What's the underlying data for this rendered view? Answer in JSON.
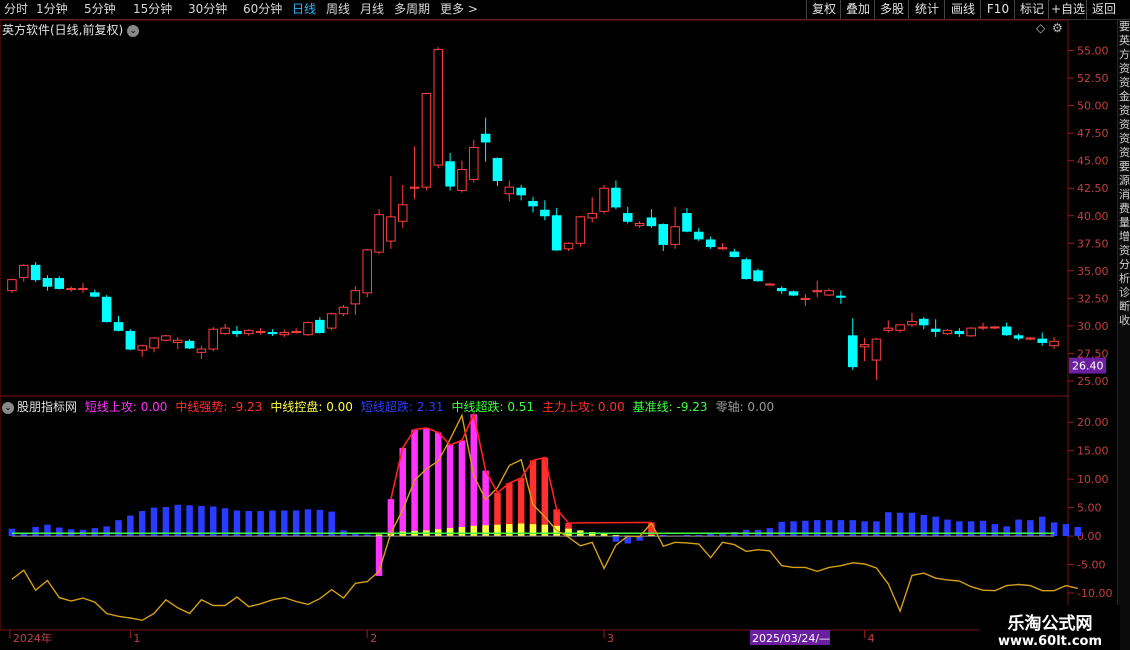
{
  "toolbar": {
    "periods": [
      "分时",
      "1分钟",
      "5分钟",
      "15分钟",
      "30分钟",
      "60分钟",
      "日线",
      "周线",
      "月线",
      "多周期",
      "更多 >"
    ],
    "active_period": "日线",
    "right_buttons": [
      "复权",
      "叠加",
      "多股",
      "统计",
      "画线",
      "F10",
      "标记",
      "+自选",
      "返回"
    ]
  },
  "chart_title": "英方软件(日线,前复权)",
  "indicator": {
    "name": "股朋指标网",
    "items": [
      {
        "label": "短线上攻: 0.00",
        "color": "#ff33ff"
      },
      {
        "label": "中线强势: -9.23",
        "color": "#ff3030"
      },
      {
        "label": "中线控盘: 0.00",
        "color": "#ffff40"
      },
      {
        "label": "短线超跌: 2.31",
        "color": "#2a3cff"
      },
      {
        "label": "中线超跌: 0.51",
        "color": "#40ff40"
      },
      {
        "label": "主力上攻: 0.00",
        "color": "#ff3030"
      },
      {
        "label": "基准线: -9.23",
        "color": "#40ff40"
      },
      {
        "label": "零轴: 0.00",
        "color": "#9a9a9a"
      }
    ]
  },
  "current_price_tag": "26.40",
  "date_axis": {
    "labels": [
      "2024年",
      "1",
      "2",
      "3",
      "4"
    ],
    "highlight": "2025/03/24/—"
  },
  "right_strip_text": "要英方资资金资资资资要源消费量增资分析诊断收",
  "watermark": {
    "line1": "乐淘公式网",
    "line2": "www.60lt.com"
  },
  "colors": {
    "up": "#ff4040",
    "down": "#00ffff",
    "bg": "#000000"
  },
  "chart_data": [
    {
      "type": "candlestick",
      "title": "英方软件(日线,前复权)",
      "ylim": [
        24.0,
        56.5
      ],
      "yticks": [
        25.0,
        27.5,
        30.0,
        32.5,
        35.0,
        37.5,
        40.0,
        42.5,
        45.0,
        47.5,
        50.0,
        52.5,
        55.0
      ],
      "ohlc": [
        [
          33.2,
          34.3,
          33.0,
          34.2
        ],
        [
          34.4,
          35.6,
          34.0,
          35.5
        ],
        [
          35.5,
          35.8,
          34.0,
          34.2
        ],
        [
          34.3,
          34.6,
          33.2,
          33.6
        ],
        [
          34.3,
          34.5,
          33.3,
          33.4
        ],
        [
          33.3,
          33.6,
          33.1,
          33.4
        ],
        [
          33.3,
          33.9,
          33.0,
          33.4
        ],
        [
          33.0,
          33.3,
          32.6,
          32.7
        ],
        [
          32.6,
          32.8,
          30.3,
          30.4
        ],
        [
          30.3,
          30.9,
          29.5,
          29.6
        ],
        [
          29.5,
          29.7,
          27.8,
          27.9
        ],
        [
          27.8,
          28.3,
          27.2,
          28.2
        ],
        [
          28.0,
          29.0,
          27.6,
          28.9
        ],
        [
          28.7,
          29.2,
          28.6,
          29.1
        ],
        [
          28.5,
          29.0,
          27.9,
          28.7
        ],
        [
          28.6,
          28.8,
          27.9,
          28.0
        ],
        [
          27.6,
          28.2,
          27.0,
          27.9
        ],
        [
          27.9,
          29.9,
          27.7,
          29.7
        ],
        [
          29.3,
          30.2,
          29.2,
          29.8
        ],
        [
          29.5,
          30.0,
          29.0,
          29.3
        ],
        [
          29.3,
          29.7,
          29.1,
          29.6
        ],
        [
          29.4,
          29.8,
          29.2,
          29.5
        ],
        [
          29.4,
          29.7,
          29.1,
          29.3
        ],
        [
          29.2,
          29.7,
          29.0,
          29.4
        ],
        [
          29.4,
          29.8,
          29.3,
          29.5
        ],
        [
          29.2,
          30.4,
          29.1,
          30.3
        ],
        [
          30.5,
          30.8,
          29.3,
          29.4
        ],
        [
          29.8,
          31.2,
          29.6,
          31.1
        ],
        [
          31.1,
          31.9,
          30.9,
          31.7
        ],
        [
          32.0,
          33.6,
          31.0,
          33.2
        ],
        [
          33.0,
          37.0,
          32.6,
          36.9
        ],
        [
          36.7,
          40.6,
          36.5,
          40.1
        ],
        [
          37.7,
          43.6,
          37.0,
          39.9
        ],
        [
          39.5,
          42.8,
          38.9,
          41.0
        ],
        [
          42.5,
          46.3,
          41.5,
          42.6
        ],
        [
          42.6,
          49.9,
          42.3,
          51.1
        ],
        [
          44.6,
          55.3,
          44.3,
          55.1
        ],
        [
          44.9,
          45.7,
          42.3,
          42.7
        ],
        [
          42.3,
          45.0,
          42.1,
          44.2
        ],
        [
          43.3,
          46.9,
          43.0,
          46.2
        ],
        [
          47.4,
          48.9,
          44.9,
          46.7
        ],
        [
          45.2,
          45.3,
          42.7,
          43.2
        ],
        [
          42.0,
          43.2,
          41.3,
          42.6
        ],
        [
          42.5,
          42.8,
          41.4,
          41.9
        ],
        [
          41.3,
          41.7,
          40.3,
          40.9
        ],
        [
          40.5,
          41.4,
          39.6,
          40.0
        ],
        [
          40.0,
          40.7,
          36.8,
          36.9
        ],
        [
          37.0,
          37.6,
          36.8,
          37.5
        ],
        [
          37.5,
          40.0,
          37.2,
          39.9
        ],
        [
          39.8,
          41.7,
          39.4,
          40.2
        ],
        [
          40.4,
          42.8,
          40.2,
          42.5
        ],
        [
          42.5,
          43.2,
          40.6,
          40.8
        ],
        [
          40.2,
          40.8,
          39.3,
          39.5
        ],
        [
          39.1,
          39.5,
          38.9,
          39.3
        ],
        [
          39.8,
          40.6,
          38.9,
          39.1
        ],
        [
          39.2,
          39.3,
          36.8,
          37.4
        ],
        [
          37.4,
          40.8,
          37.0,
          39.0
        ],
        [
          40.2,
          40.7,
          38.5,
          38.6
        ],
        [
          38.5,
          38.9,
          37.7,
          37.9
        ],
        [
          37.8,
          38.1,
          37.0,
          37.2
        ],
        [
          37.0,
          37.5,
          36.9,
          37.1
        ],
        [
          36.7,
          37.0,
          36.2,
          36.3
        ],
        [
          36.0,
          36.2,
          34.2,
          34.3
        ],
        [
          35.0,
          35.2,
          34.0,
          34.1
        ],
        [
          33.8,
          33.9,
          33.7,
          33.8
        ],
        [
          33.4,
          33.6,
          32.9,
          33.2
        ],
        [
          33.1,
          33.2,
          32.7,
          32.8
        ],
        [
          32.4,
          32.9,
          31.8,
          32.5
        ],
        [
          33.1,
          34.1,
          32.6,
          33.2
        ],
        [
          32.8,
          33.4,
          32.7,
          33.2
        ],
        [
          32.7,
          33.2,
          32.0,
          32.6
        ],
        [
          29.1,
          30.7,
          26.0,
          26.3
        ],
        [
          28.1,
          28.9,
          26.8,
          28.3
        ],
        [
          26.9,
          28.9,
          25.1,
          28.8
        ],
        [
          29.6,
          30.5,
          29.4,
          29.8
        ],
        [
          29.6,
          30.1,
          29.4,
          30.1
        ],
        [
          30.1,
          31.2,
          29.9,
          30.4
        ],
        [
          30.6,
          30.8,
          29.7,
          30.1
        ],
        [
          29.7,
          30.6,
          29.0,
          29.5
        ],
        [
          29.3,
          29.7,
          29.2,
          29.6
        ],
        [
          29.5,
          29.8,
          29.0,
          29.3
        ],
        [
          29.1,
          29.9,
          29.0,
          29.8
        ],
        [
          29.8,
          30.3,
          29.6,
          29.9
        ],
        [
          29.9,
          30.0,
          29.7,
          29.9
        ],
        [
          29.9,
          30.3,
          29.1,
          29.2
        ],
        [
          29.1,
          29.3,
          28.7,
          28.9
        ],
        [
          28.8,
          29.0,
          28.7,
          28.9
        ],
        [
          28.8,
          29.4,
          28.2,
          28.5
        ],
        [
          28.2,
          29.0,
          27.9,
          28.6
        ]
      ]
    },
    {
      "type": "bar",
      "title": "股朋指标网",
      "ylim": [
        -16.5,
        22.5
      ],
      "yticks": [
        -15.0,
        -10.0,
        -5.0,
        0.0,
        5.0,
        10.0,
        15.0,
        20.0
      ],
      "series": [
        {
          "name": "短线超跌",
          "color": "#2a3cff",
          "values": [
            1.3,
            0.6,
            1.6,
            2.0,
            1.5,
            1.2,
            1.1,
            1.4,
            1.7,
            2.8,
            3.6,
            4.4,
            5.0,
            5.1,
            5.5,
            5.4,
            5.3,
            5.2,
            4.9,
            4.5,
            4.4,
            4.4,
            4.5,
            4.5,
            4.5,
            4.7,
            4.6,
            4.3,
            1.0,
            0.4,
            0.3,
            0.2,
            0.2,
            0.2,
            0.2,
            0.2,
            0.2,
            0.2,
            0.2,
            0.2,
            0.2,
            0.2,
            0.2,
            0.2,
            0.2,
            0.2,
            0.3,
            0.8,
            0.7,
            0.2,
            0.1,
            -1.0,
            -1.3,
            -0.8,
            0.2,
            0.2,
            0.1,
            0.2,
            0.2,
            0.4,
            0.4,
            0.7,
            1.1,
            1.1,
            1.4,
            2.5,
            2.6,
            2.7,
            2.8,
            2.8,
            2.8,
            2.8,
            2.6,
            2.6,
            4.2,
            4.1,
            4.1,
            3.7,
            3.4,
            2.9,
            2.6,
            2.6,
            2.7,
            2.1,
            1.7,
            2.9,
            2.8,
            3.4,
            2.4,
            2.1,
            1.6
          ]
        },
        {
          "name": "短线上攻",
          "color": "#ff33ff",
          "values": [
            0,
            0,
            0,
            0,
            0,
            0,
            0,
            0,
            0,
            0,
            0,
            0,
            0,
            0,
            0,
            0,
            0,
            0,
            0,
            0,
            0,
            0,
            0,
            0,
            0,
            0,
            0,
            0,
            0,
            0,
            0,
            -7.0,
            6.5,
            15.5,
            18.7,
            19.0,
            18.2,
            16.0,
            16.8,
            21.4,
            11.5,
            0,
            0,
            0,
            0,
            0,
            0,
            0,
            0,
            0,
            0,
            0,
            0,
            0,
            0,
            0,
            0,
            0,
            0,
            0,
            0,
            0,
            0,
            0,
            0,
            0,
            0,
            0,
            0,
            0,
            0,
            0,
            0,
            0,
            0,
            0,
            0,
            0,
            0,
            0,
            0,
            0,
            0,
            0,
            0,
            0,
            0,
            0,
            0,
            0
          ]
        },
        {
          "name": "主力上攻",
          "color": "#ff3030",
          "values": [
            0,
            0,
            0,
            0,
            0,
            0,
            0,
            0,
            0,
            0,
            0,
            0,
            0,
            0,
            0,
            0,
            0,
            0,
            0,
            0,
            0,
            0,
            0,
            0,
            0,
            0,
            0,
            0,
            0,
            0,
            0,
            0,
            0,
            0,
            0,
            0,
            0,
            0,
            0,
            0,
            0,
            7.6,
            9.3,
            10.2,
            13.3,
            13.8,
            4.7,
            2.3,
            0,
            0,
            0,
            0,
            0,
            0,
            2.4,
            0,
            0,
            0,
            0,
            0,
            0,
            0,
            0,
            0,
            0,
            0,
            0,
            0,
            0,
            0,
            0,
            0,
            0,
            0,
            0,
            0,
            0,
            0,
            0,
            0,
            0,
            0,
            0,
            0,
            0,
            0,
            0,
            0,
            0,
            0,
            0
          ]
        },
        {
          "name": "中线控盘",
          "color": "#ffff40",
          "values": [
            0,
            0,
            0,
            0,
            0,
            0,
            0,
            0,
            0,
            0,
            0,
            0,
            0,
            0,
            0,
            0,
            0,
            0,
            0,
            0,
            0,
            0,
            0,
            0,
            0,
            0,
            0,
            0,
            0,
            0,
            0,
            0.3,
            0.6,
            0.8,
            0.9,
            1.0,
            1.2,
            1.4,
            1.6,
            1.8,
            1.9,
            2.0,
            2.1,
            2.2,
            2.1,
            2.0,
            1.8,
            1.3,
            1.0,
            0.7,
            0.4,
            0.2,
            0.1,
            0,
            0.2,
            0,
            0,
            0,
            0,
            0,
            0,
            0,
            0,
            0,
            0,
            0,
            0,
            0,
            0,
            0,
            0,
            0,
            0,
            0,
            0,
            0,
            0,
            0,
            0,
            0,
            0,
            0,
            0,
            0,
            0,
            0,
            0,
            0,
            0,
            0,
            0
          ]
        },
        {
          "name": "中线强势",
          "color": "#d4a017",
          "values": [
            -7.6,
            -6.0,
            -9.5,
            -7.8,
            -10.8,
            -11.4,
            -10.9,
            -11.6,
            -13.6,
            -14.1,
            -14.4,
            -14.8,
            -13.6,
            -11.2,
            -12.6,
            -13.6,
            -11.2,
            -12.2,
            -12.2,
            -10.7,
            -12.4,
            -11.9,
            -11.2,
            -10.8,
            -11.5,
            -12.0,
            -11.0,
            -9.4,
            -10.9,
            -8.3,
            -8.0,
            -6.2,
            0.5,
            4.6,
            9.8,
            11.8,
            13.2,
            17.0,
            21.2,
            10.6,
            6.4,
            8.5,
            12.4,
            13.4,
            5.5,
            3.4,
            1.0,
            -0.2,
            -1.7,
            -1.1,
            -5.7,
            -1.6,
            0.0,
            -0.1,
            2.3,
            -1.8,
            -1.1,
            -1.2,
            -1.4,
            -3.8,
            -1.1,
            -1.5,
            -2.7,
            -2.4,
            -2.6,
            -5.2,
            -5.5,
            -5.5,
            -6.2,
            -5.5,
            -5.2,
            -4.7,
            -4.9,
            -5.6,
            -8.4,
            -13.2,
            -6.9,
            -6.5,
            -7.4,
            -7.7,
            -7.9,
            -8.9,
            -9.5,
            -9.6,
            -8.7,
            -8.5,
            -8.7,
            -9.6,
            -9.6,
            -8.7,
            -9.2
          ]
        },
        {
          "name": "中线超跌",
          "color": "#40ff40",
          "values_constant": 0.51
        },
        {
          "name": "零轴",
          "color": "#9a9a9a",
          "values_constant": 0.0
        }
      ]
    }
  ]
}
